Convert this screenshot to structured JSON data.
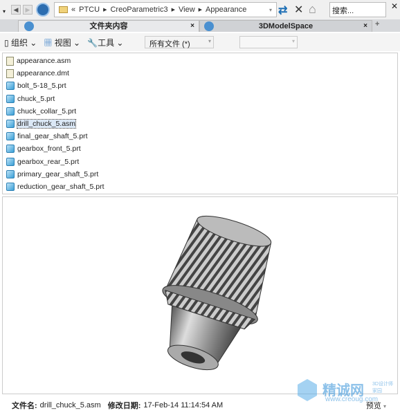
{
  "nav": {
    "path": [
      "PTCU",
      "CreoParametric3",
      "View",
      "Appearance"
    ],
    "path_prefix": "«",
    "search_placeholder": "搜索...",
    "close": "✕"
  },
  "tabs": [
    {
      "label": "文件夹内容",
      "close": "×"
    },
    {
      "label": "3DModelSpace",
      "close": "×"
    }
  ],
  "new_tab": "+",
  "commands": {
    "organize": "组织",
    "view": "视图",
    "tools": "工具",
    "filter": "所有文件 (*)"
  },
  "files": [
    {
      "name": "appearance.asm",
      "icon": "document-icon"
    },
    {
      "name": "appearance.dmt",
      "icon": "document-icon"
    },
    {
      "name": "bolt_5-18_5.prt",
      "icon": "part-icon"
    },
    {
      "name": "chuck_5.prt",
      "icon": "part-icon"
    },
    {
      "name": "chuck_collar_5.prt",
      "icon": "part-icon"
    },
    {
      "name": "drill_chuck_5.asm",
      "icon": "assembly-icon",
      "selected": true
    },
    {
      "name": "final_gear_shaft_5.prt",
      "icon": "part-icon"
    },
    {
      "name": "gearbox_front_5.prt",
      "icon": "part-icon"
    },
    {
      "name": "gearbox_rear_5.prt",
      "icon": "part-icon"
    },
    {
      "name": "primary_gear_shaft_5.prt",
      "icon": "part-icon"
    },
    {
      "name": "reduction_gear_shaft_5.prt",
      "icon": "part-icon"
    }
  ],
  "status": {
    "filename_label": "文件名:",
    "filename": "drill_chuck_5.asm",
    "modified_label": "修改日期:",
    "modified": "17-Feb-14 11:14:54 AM",
    "preview": "预览"
  },
  "watermark": {
    "brand": "精诚网",
    "sub": "3D设计师家园",
    "url": "www.creoug.com"
  }
}
